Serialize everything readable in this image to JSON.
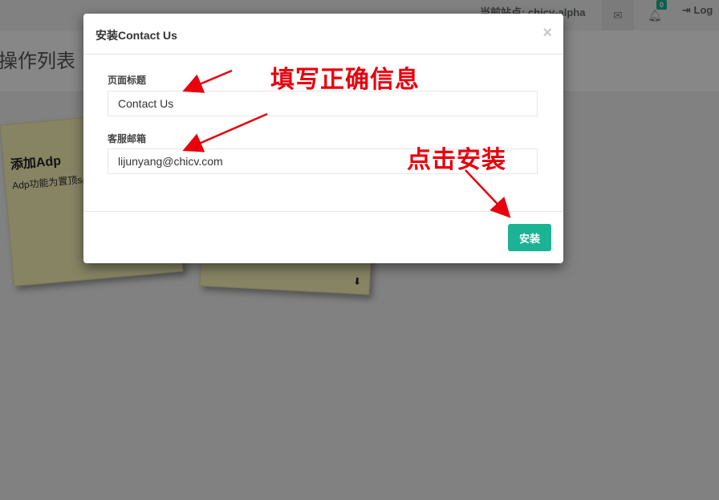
{
  "topbar": {
    "site_label": "当前站点: chicv-alpha",
    "envelope_icon": "envelope-icon",
    "bell_icon": "bell-icon",
    "notification_count": "0",
    "logout_icon": "sign-out-icon",
    "logout_label": "Log"
  },
  "page": {
    "heading": "y操作列表"
  },
  "cards": [
    {
      "title": "添加Adp",
      "description": "Adp功能为置顶s品，通过改变链接",
      "download_icon": "download-icon"
    },
    {
      "download_icon": "download-icon"
    }
  ],
  "modal": {
    "title": "安装Contact Us",
    "close_label": "×",
    "fields": [
      {
        "label": "页面标题",
        "value": "Contact Us"
      },
      {
        "label": "客服邮箱",
        "value": "lijunyang@chicv.com"
      }
    ],
    "install_label": "安装"
  },
  "annotations": {
    "fill_correct_info": "填写正确信息",
    "click_install": "点击安装",
    "color": "#e8000d"
  },
  "colors": {
    "accent": "#1ab394",
    "card_bg": "#fefabc"
  }
}
